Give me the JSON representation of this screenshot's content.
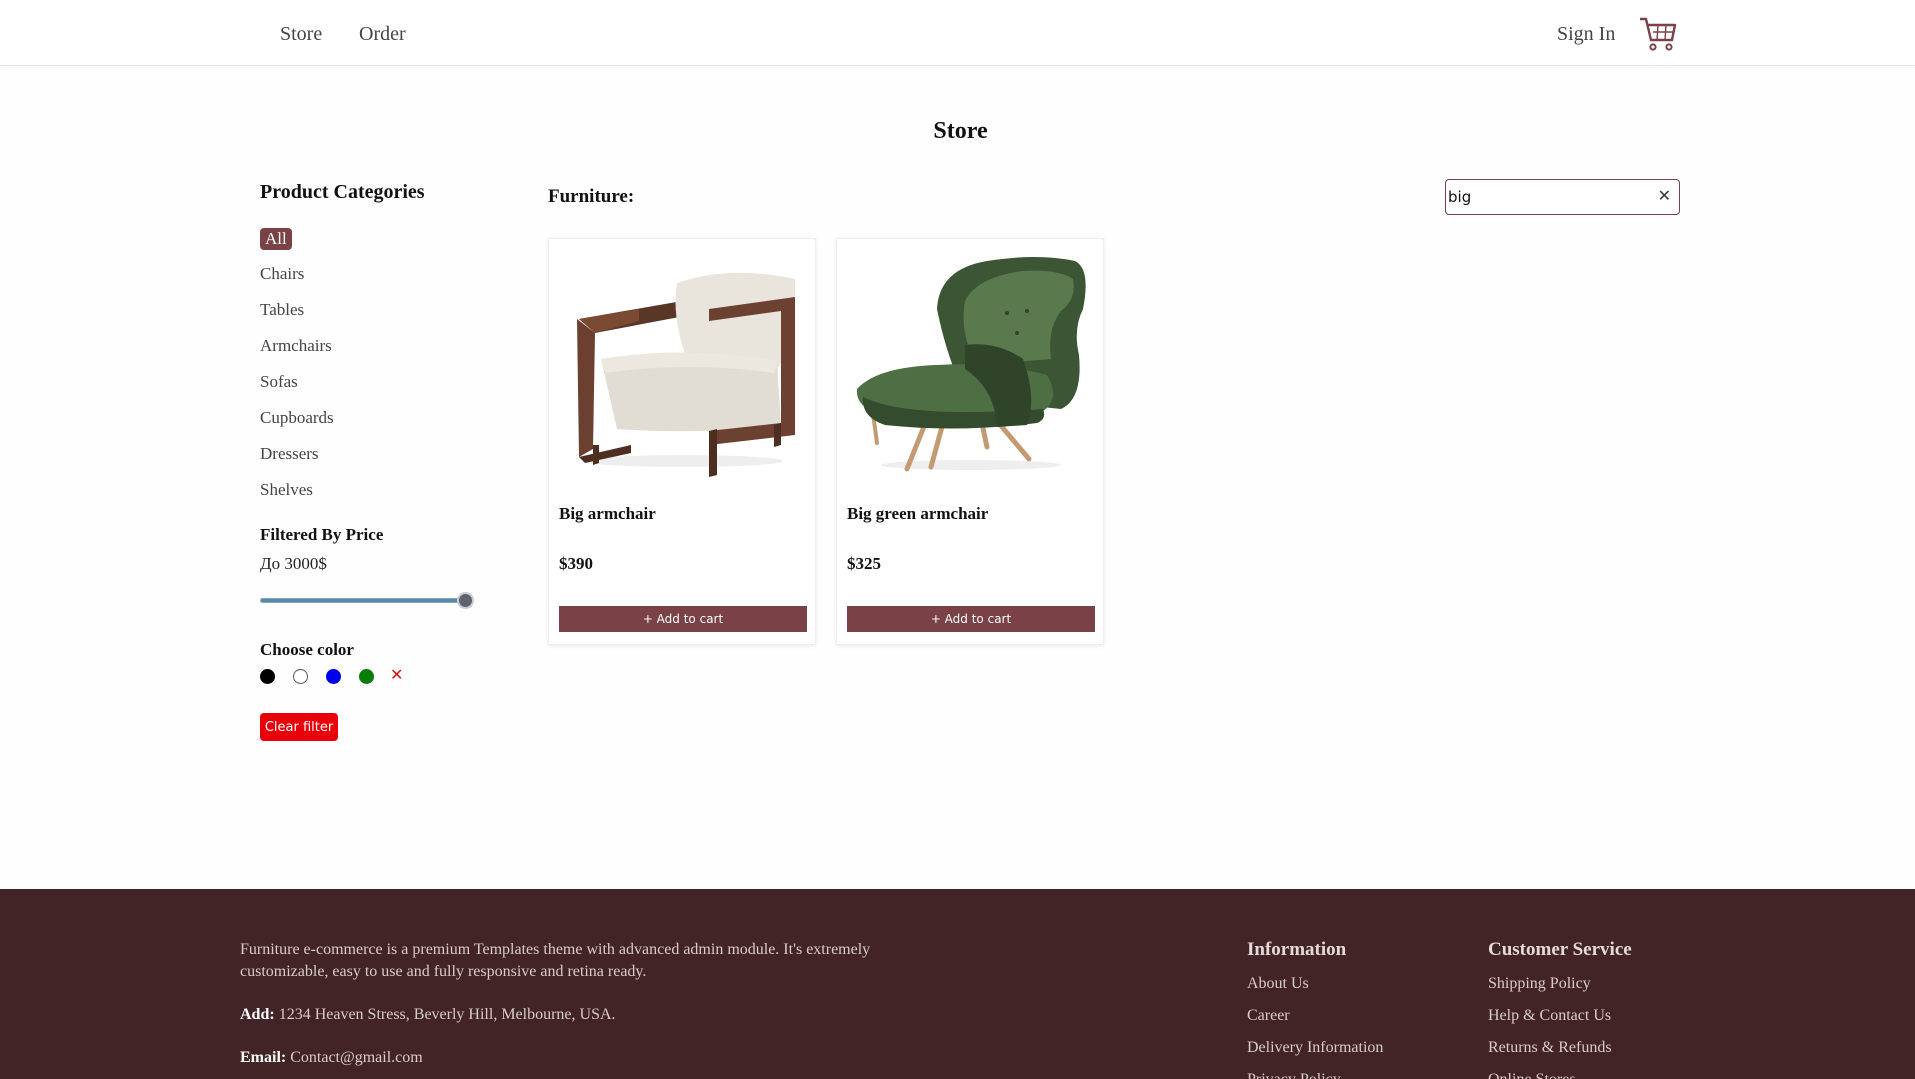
{
  "header": {
    "nav": [
      "Store",
      "Order"
    ],
    "sign_in": "Sign In",
    "cart_icon": "shopping-cart-icon"
  },
  "page": {
    "title": "Store"
  },
  "sidebar": {
    "categories_title": "Product Categories",
    "categories": [
      "All",
      "Chairs",
      "Tables",
      "Armchairs",
      "Sofas",
      "Cupboards",
      "Dressers",
      "Shelves"
    ],
    "selected_category": "All",
    "price_title": "Filtered By Price",
    "price_label": "До 3000$",
    "price_slider_value": 1.0,
    "color_title": "Choose color",
    "colors": [
      "#000000",
      "#ffffff",
      "#0000ee",
      "#0a7c0a"
    ],
    "clear_color_icon": "x-icon",
    "clear_filter": "Clear filter"
  },
  "main": {
    "section_label": "Furniture:",
    "search": {
      "value": "big",
      "clear_icon": "close-icon"
    },
    "products": [
      {
        "name": "Big armchair",
        "price": "$390",
        "button": "+ Add to cart"
      },
      {
        "name": "Big green armchair",
        "price": "$325",
        "button": "+ Add to cart"
      }
    ]
  },
  "footer": {
    "description": "Furniture e-commerce is a premium Templates theme with advanced admin module. It's extremely customizable, easy to use and fully responsive and retina ready.",
    "address_label": "Add:",
    "address": "1234 Heaven Stress, Beverly Hill, Melbourne, USA.",
    "email_label": "Email:",
    "email": "Contact@gmail.com",
    "information": {
      "title": "Information",
      "links": [
        "About Us",
        "Career",
        "Delivery Information",
        "Privacy Policy"
      ]
    },
    "customer_service": {
      "title": "Customer Service",
      "links": [
        "Shipping Policy",
        "Help & Contact Us",
        "Returns & Refunds",
        "Online Stores"
      ]
    }
  },
  "colors": {
    "accent": "#7a4146",
    "footer_bg": "#432426",
    "danger": "#e8000b"
  }
}
